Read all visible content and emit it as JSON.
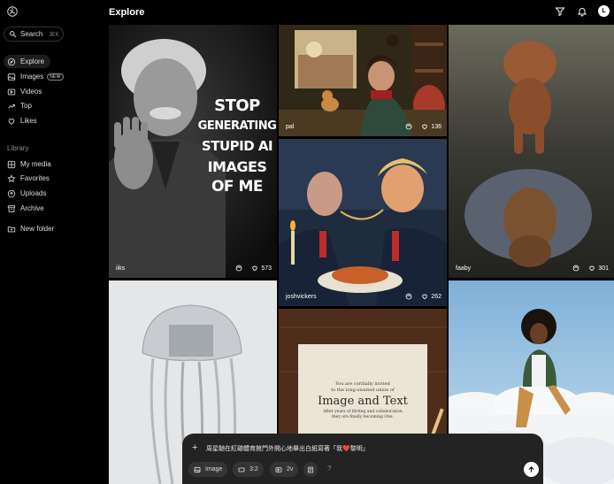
{
  "sidebar": {
    "search": {
      "label": "Search",
      "shortcut": "⌘K"
    },
    "nav": [
      {
        "label": "Explore",
        "icon": "compass-icon",
        "active": true
      },
      {
        "label": "Images",
        "icon": "image-icon",
        "badge": "NEW"
      },
      {
        "label": "Videos",
        "icon": "video-icon"
      },
      {
        "label": "Top",
        "icon": "arrow-up-icon"
      },
      {
        "label": "Likes",
        "icon": "heart-icon"
      }
    ],
    "library_label": "Library",
    "library": [
      {
        "label": "My media",
        "icon": "grid-icon"
      },
      {
        "label": "Favorites",
        "icon": "star-icon"
      },
      {
        "label": "Uploads",
        "icon": "upload-icon"
      },
      {
        "label": "Archive",
        "icon": "archive-icon"
      }
    ],
    "new_folder": {
      "label": "New folder",
      "icon": "folder-plus-icon"
    }
  },
  "header": {
    "title": "Explore",
    "avatar_initial": "L"
  },
  "tiles": [
    {
      "author": "iiks",
      "likes": "573",
      "overlay_text": [
        "STOP",
        "GENERATING",
        "STUPID AI",
        "IMAGES",
        "OF ME"
      ]
    },
    {
      "author": "pal",
      "likes": "136"
    },
    {
      "author": "faaby",
      "likes": "301"
    },
    {
      "author": "joshvickers",
      "likes": "262"
    },
    {
      "card_lines": [
        "You are cordially invited",
        "to the long-awaited union of",
        "Image and Text",
        "After years of flirting and collaboration",
        "they are finally becoming One."
      ]
    }
  ],
  "composer": {
    "prompt": "周星馳在紅磡體育館門外開心地舉出白紙寫著「我❤️黎明」",
    "mode": "Image",
    "aspect": "3:2",
    "variations": "2v",
    "help": "?"
  },
  "colors": {
    "background": "#000000",
    "composer": "#232323",
    "chip": "#343434"
  }
}
